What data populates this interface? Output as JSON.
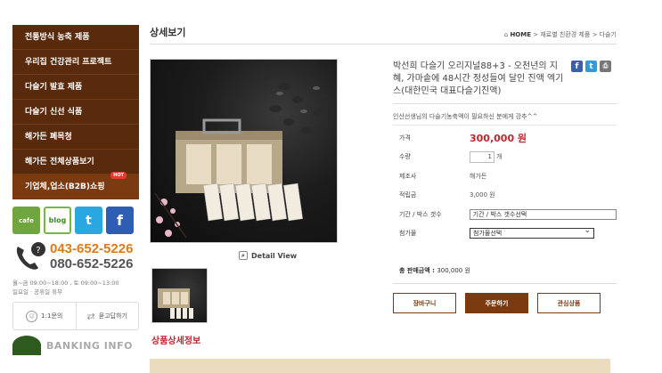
{
  "sidebar": {
    "menu": [
      "전통방식 농축 제품",
      "우리집 건강관리 프로젝트",
      "다슬기 발효 제품",
      "다슬기 신선 식품",
      "해가든 폐목청",
      "해가든 전체상품보기",
      "기업체,업소(B2B)쇼핑"
    ],
    "hot_badge": "HOT",
    "social": {
      "cafe": "cafe",
      "blog": "blog",
      "twitter": "t",
      "facebook": "f"
    },
    "phone1": "043-652-5226",
    "phone2": "080-652-5226",
    "hours1": "월~금 09:00~18:00 , 토 09:00~13:00",
    "hours2": "일요일 · 공휴일 휴무",
    "qa_left": "1:1문의",
    "qa_right": "묻고답하기",
    "bank": "BANKING INFO"
  },
  "main": {
    "title": "상세보기",
    "breadcrumb": {
      "home": "HOME",
      "sep": ">",
      "cat": "재료별 친환경 제품",
      "leaf": "다슬기"
    },
    "zoom_label": "Detail View",
    "detail_link": "상품상세정보"
  },
  "product": {
    "name": "박선희 다슬기 오리지널88+3 - 오천년의 지혜, 가마솥에 48시간 정성들여 달인 진액 엑기스(대한민국 대표다슬기진액)",
    "description": "인산선생님의 다슬기농축액이 필요하신 분에게 강추^^",
    "labels": {
      "price": "가격",
      "qty": "수량",
      "maker": "제조사",
      "points": "적립금",
      "period": "기간 / 박스 갯수",
      "addon": "첨가물"
    },
    "price": "300,000 원",
    "qty": "1",
    "qty_unit": "개",
    "maker": "해가든",
    "points": "3,000 원",
    "period_select": "기간 / 박스 갯수선택",
    "addon_select": "첨가물선택",
    "total_label": "총 판매금액 : ",
    "total_value": "300,000 원"
  },
  "buttons": {
    "cart": "장바구니",
    "order": "주문하기",
    "wish": "관심상품"
  },
  "colors": {
    "menu_bg": "#5a2a0c",
    "accent": "#7b3a10",
    "price": "#c0262c",
    "phone": "#e07b14"
  }
}
